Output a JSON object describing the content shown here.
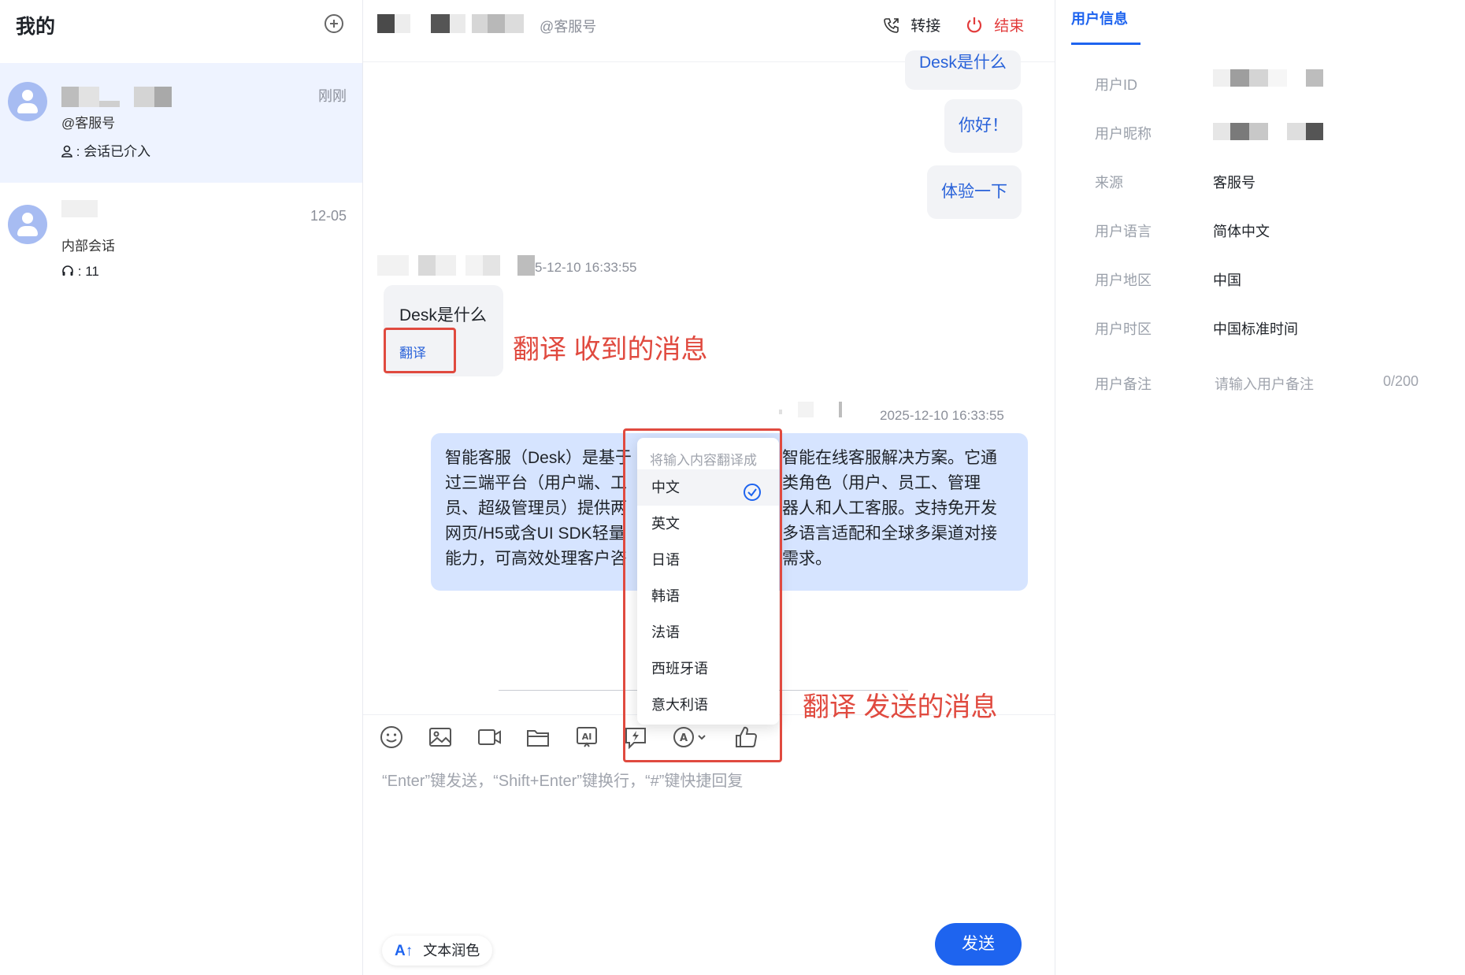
{
  "sidebar": {
    "title": "我的",
    "conversations": [
      {
        "time": "刚刚",
        "channel": "@客服号",
        "status": "会话已介入"
      },
      {
        "time": "12-05",
        "channel": "内部会话",
        "status": "11"
      }
    ]
  },
  "chat": {
    "header": {
      "channel": "@客服号",
      "transfer": "转接",
      "end": "结束"
    },
    "messages_right": [
      "Desk是什么",
      "你好！",
      "体验一下"
    ],
    "received": {
      "timestamp": "5-12-10 16:33:55",
      "text": "Desk是什么",
      "translate": "翻译"
    },
    "annotation_received": "翻译 收到的消息",
    "sent": {
      "timestamp": "2025-12-10 16:33:55",
      "lines": [
        "智能客服（Desk）是基于",
        "智能在线客服解决方案。它通",
        "过三端平台（用户端、工",
        "类角色（用户、员工、管理",
        "员、超级管理员）提供两",
        "器人和人工客服。支持免开发",
        "网页/H5或含UI SDK轻量",
        "多语言适配和全球多渠道对接",
        "能力，可高效处理客户咨",
        "需求。"
      ]
    },
    "translate_menu": {
      "header": "将输入内容翻译成",
      "options": [
        "中文",
        "英文",
        "日语",
        "韩语",
        "法语",
        "西班牙语",
        "意大利语"
      ],
      "selected": "中文"
    },
    "annotation_sent": "翻译 发送的消息",
    "input_placeholder": "“Enter”键发送，“Shift+Enter”键换行，“#”键快捷回复",
    "polish": "文本润色",
    "send": "发送",
    "toolbar_icons": [
      "emoji-icon",
      "image-icon",
      "video-icon",
      "folder-icon",
      "ai-icon",
      "quick-reply-icon",
      "translate-icon",
      "thumbs-up-icon"
    ]
  },
  "user_info": {
    "tab": "用户信息",
    "fields": [
      {
        "label": "用户ID",
        "value": ""
      },
      {
        "label": "用户昵称",
        "value": ""
      },
      {
        "label": "来源",
        "value": "客服号"
      },
      {
        "label": "用户语言",
        "value": "简体中文"
      },
      {
        "label": "用户地区",
        "value": "中国"
      },
      {
        "label": "用户时区",
        "value": "中国标准时间"
      },
      {
        "label": "用户备注",
        "value": ""
      }
    ],
    "remark_placeholder": "请输入用户备注",
    "remark_count": "0/200"
  },
  "colors": {
    "accent": "#1e64ef",
    "annotation_red": "#e04a3f",
    "active_conv_bg": "#eef3ff",
    "sent_bubble": "#d6e4ff"
  }
}
